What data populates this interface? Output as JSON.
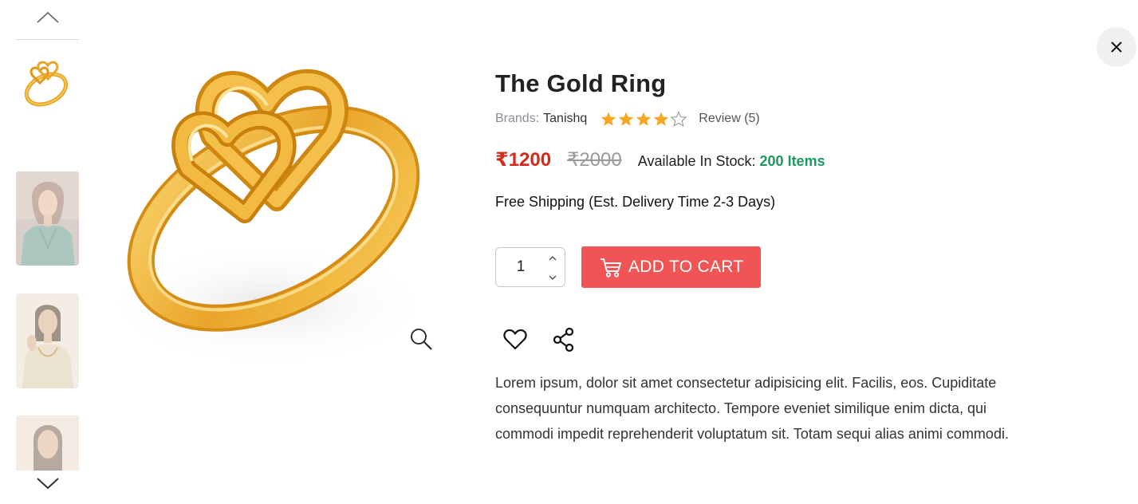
{
  "gallery": {
    "scroll_up_icon": "chevron-up-icon",
    "scroll_down_icon": "chevron-down-icon",
    "thumbnails": [
      {
        "kind": "ring-product",
        "selected": true
      },
      {
        "kind": "model-photo",
        "selected": false
      },
      {
        "kind": "model-photo",
        "selected": false
      },
      {
        "kind": "model-photo",
        "selected": false
      }
    ],
    "zoom_icon": "magnifier-icon"
  },
  "close_icon": "close-icon",
  "product": {
    "title": "The Gold Ring",
    "brand_label": "Brands:",
    "brand_value": "Tanishq",
    "rating": 4,
    "rating_max": 5,
    "review_text": "Review (5)",
    "price_current": "₹1200",
    "price_old": "₹2000",
    "stock_label": "Available In Stock:",
    "stock_value": "200 Items",
    "shipping": "Free Shipping (Est. Delivery Time 2-3 Days)",
    "quantity": "1",
    "add_to_cart_label": "ADD TO CART",
    "description": "Lorem ipsum, dolor sit amet consectetur adipisicing elit. Facilis, eos. Cupiditate consequuntur numquam architecto. Tempore eveniet similique enim dicta, qui commodi impedit reprehenderit voluptatum sit. Totam sequi alias animi commodi."
  },
  "colors": {
    "price_current": "#d52a1b",
    "stock_value": "#1a9a5f",
    "cart_button": "#f05454",
    "star": "#f5a623"
  }
}
